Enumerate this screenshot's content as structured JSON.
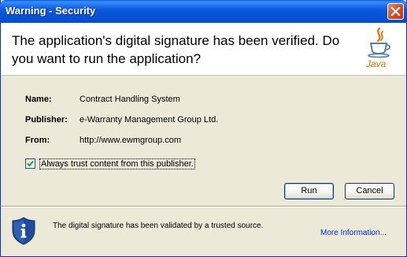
{
  "window": {
    "title": "Warning - Security",
    "close_icon": "close-icon"
  },
  "header": {
    "message": "The application's digital signature has been verified.  Do you want to run the application?",
    "logo": "java-logo",
    "logo_text": "Java"
  },
  "details": {
    "name_label": "Name:",
    "name_value": "Contract Handling System",
    "publisher_label": "Publisher:",
    "publisher_value": "e-Warranty Management Group Ltd.",
    "from_label": "From:",
    "from_value": "http://www.ewmgroup.com"
  },
  "trust": {
    "label": "Always trust content from this publisher.",
    "checked": true
  },
  "buttons": {
    "run": "Run",
    "cancel": "Cancel"
  },
  "footer": {
    "icon": "info-shield-icon",
    "message": "The digital signature has been validated by a trusted source.",
    "more_info": "More Information..."
  },
  "colors": {
    "titlebar": "#0a4ad0",
    "dialog_bg": "#ece9d8",
    "link": "#0030c8",
    "close_button": "#d4522e",
    "shield": "#1e4c9a"
  }
}
